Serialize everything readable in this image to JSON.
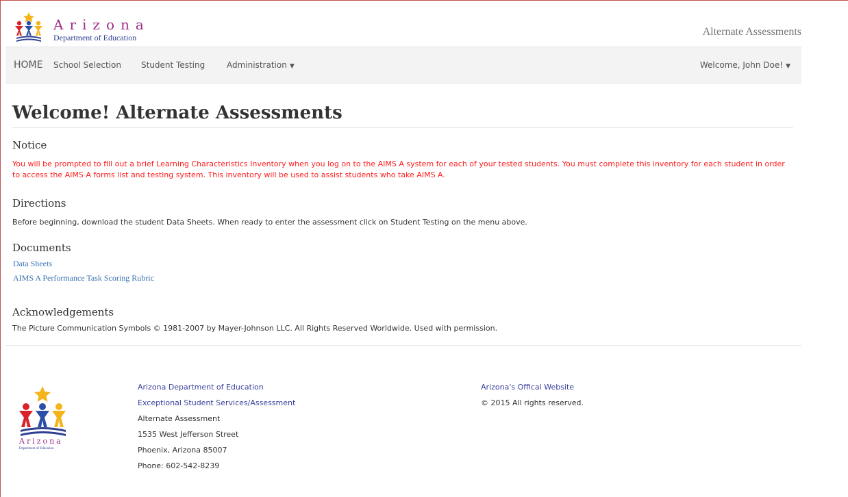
{
  "header": {
    "logo_word": "Arizona",
    "logo_sub": "Department of Education",
    "app_title": "Alternate Assessments"
  },
  "nav": {
    "home": "HOME",
    "items": [
      "School Selection",
      "Student Testing",
      "Administration"
    ],
    "user_menu": "Welcome, John Doe!"
  },
  "main": {
    "title": "Welcome! Alternate Assessments",
    "notice": {
      "heading": "Notice",
      "text": "You will be prompted to fill out a brief Learning Characteristics Inventory when you log on to the AIMS A system for each of your tested students. You must complete this inventory for each student in order to access the AIMS A forms list and testing system. This inventory will be used to assist students who take AIMS A."
    },
    "directions": {
      "heading": "Directions",
      "text": "Before beginning, download the student Data Sheets. When ready to enter the assessment click on Student Testing on the menu above."
    },
    "documents": {
      "heading": "Documents",
      "links": [
        "Data Sheets",
        "AIMS A Performance Task Scoring Rubric"
      ]
    },
    "acknowledgements": {
      "heading": "Acknowledgements",
      "text": "The Picture Communication Symbols © 1981-2007 by Mayer-Johnson LLC. All Rights Reserved Worldwide. Used with permission."
    }
  },
  "footer": {
    "logo_word": "Arizona",
    "logo_sub": "Department of Education",
    "org_link": "Arizona Department of Education",
    "dept_link": "Exceptional Student Services/Assessment",
    "lines": [
      "Alternate Assessment",
      "1535 West Jefferson Street",
      "Phoenix, Arizona 85007",
      "Phone: 602-542-8239"
    ],
    "official_link": "Arizona's Offical Website",
    "copyright": "© 2015 All rights reserved."
  },
  "colors": {
    "notice_red": "#ff1a1a",
    "link_blue": "#3b72b0",
    "brand_purple": "#9c2a86",
    "brand_navy": "#2d3f91",
    "star_gold": "#f4b41a"
  }
}
